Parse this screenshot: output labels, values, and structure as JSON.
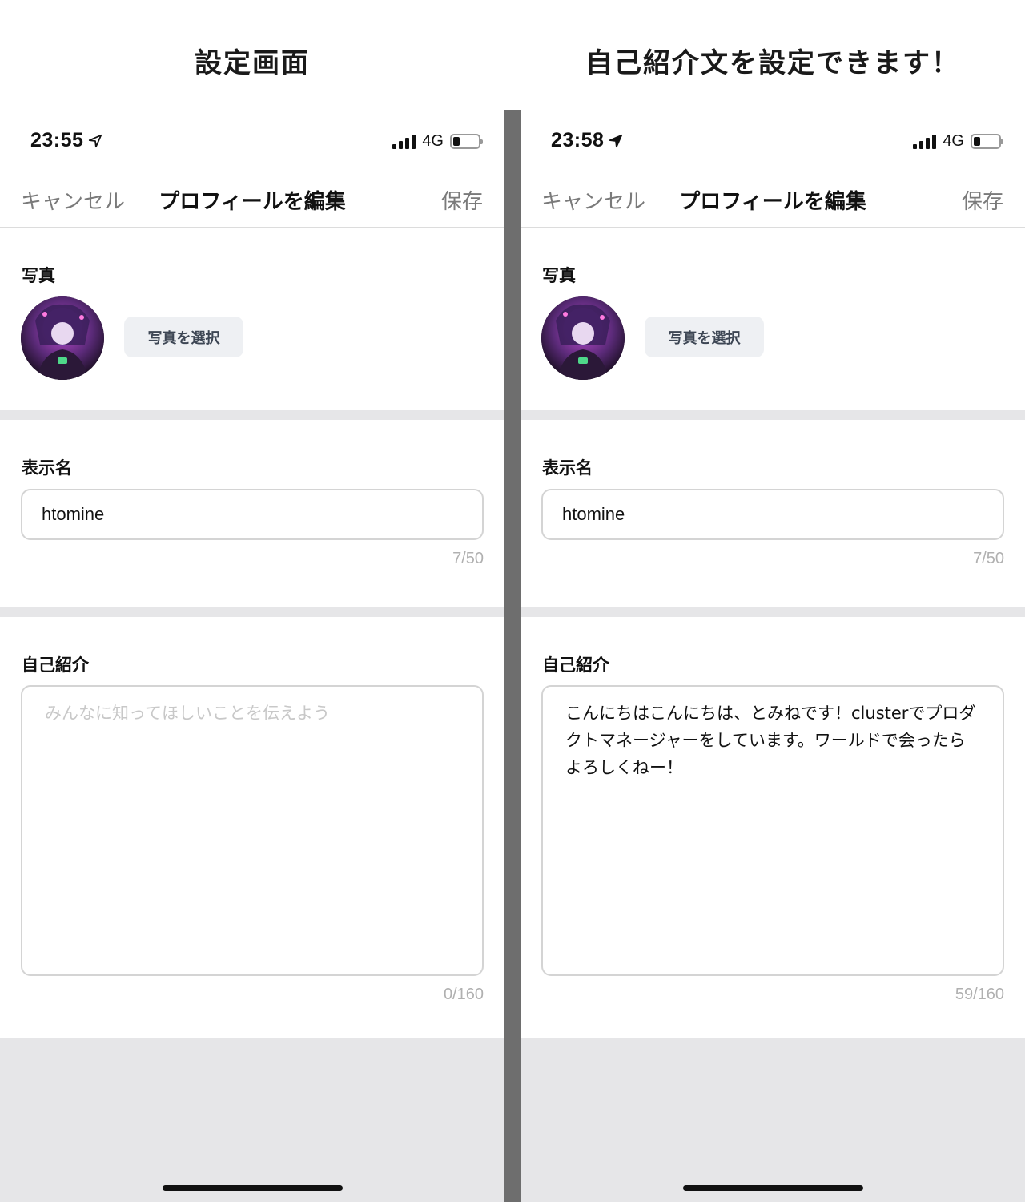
{
  "captions": {
    "left": "設定画面",
    "right": "自己紹介文を設定できます！"
  },
  "screens": [
    {
      "status": {
        "time": "23:55",
        "network": "4G"
      },
      "nav": {
        "cancel": "キャンセル",
        "title": "プロフィールを編集",
        "save": "保存"
      },
      "photo": {
        "label": "写真",
        "button": "写真を選択"
      },
      "display_name": {
        "label": "表示名",
        "value": "htomine",
        "counter": "7/50"
      },
      "bio": {
        "label": "自己紹介",
        "placeholder": "みんなに知ってほしいことを伝えよう",
        "value": "",
        "counter": "0/160"
      }
    },
    {
      "status": {
        "time": "23:58",
        "network": "4G"
      },
      "nav": {
        "cancel": "キャンセル",
        "title": "プロフィールを編集",
        "save": "保存"
      },
      "photo": {
        "label": "写真",
        "button": "写真を選択"
      },
      "display_name": {
        "label": "表示名",
        "value": "htomine",
        "counter": "7/50"
      },
      "bio": {
        "label": "自己紹介",
        "placeholder": "",
        "value": "こんにちはこんにちは、とみねです！clusterでプロダクトマネージャーをしています。ワールドで会ったらよろしくねー！",
        "counter": "59/160"
      }
    }
  ],
  "colors": {
    "divider": "#6e6e6e",
    "section_gap": "#e6e6e8",
    "button_bg": "#eef0f3",
    "muted_text": "#7a7a7a"
  },
  "icons": [
    "location-arrow-icon",
    "signal-bars-icon",
    "battery-icon"
  ]
}
